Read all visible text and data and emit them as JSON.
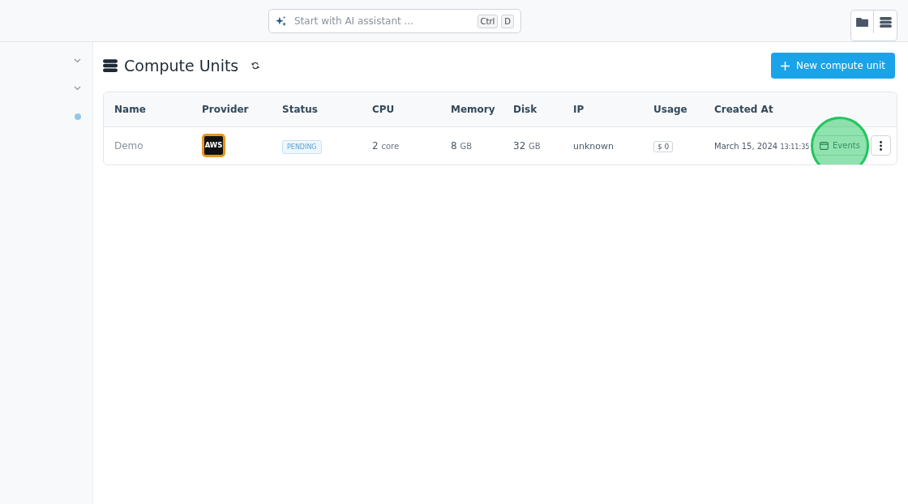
{
  "topbar": {
    "search": {
      "placeholder": "Start with AI assistant ...",
      "keys": [
        "Ctrl",
        "D"
      ]
    }
  },
  "sidebar": {
    "items": [
      {
        "kind": "chevron"
      },
      {
        "kind": "chevron"
      },
      {
        "kind": "dot",
        "color": "#90c8ea"
      }
    ]
  },
  "page": {
    "title": "Compute Units",
    "new_button": "New compute unit"
  },
  "table": {
    "columns": [
      "Name",
      "Provider",
      "Status",
      "CPU",
      "Memory",
      "Disk",
      "IP",
      "Usage",
      "Created At"
    ],
    "rows": [
      {
        "name": "Demo",
        "provider": "AWS",
        "status": "PENDING",
        "cpu": "2",
        "cpu_unit": "core",
        "memory": "8",
        "memory_unit": "GB",
        "disk": "32",
        "disk_unit": "GB",
        "ip": "unknown",
        "usage": "$ 0",
        "created_date": "March 15, 2024",
        "created_time": "13:11:35",
        "events_button": "Events",
        "click_highlighted": true
      }
    ]
  }
}
